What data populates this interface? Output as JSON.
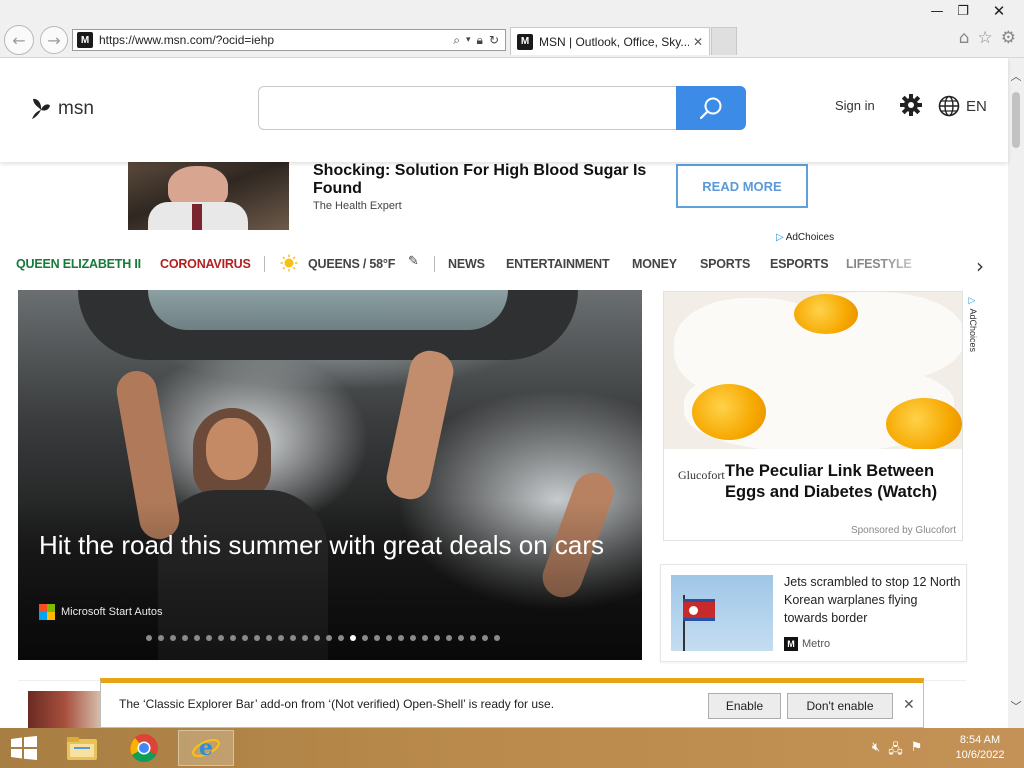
{
  "browser": {
    "url": "https://www.msn.com/?ocid=iehp",
    "tab_title": "MSN | Outlook, Office, Sky...",
    "favicon_letter": "M"
  },
  "header": {
    "brand": "msn",
    "search_placeholder": "",
    "signin": "Sign in",
    "language": "EN"
  },
  "banner_ad": {
    "headline": "Shocking: Solution For High Blood Sugar Is Found",
    "source": "The Health Expert",
    "cta": "READ MORE",
    "adchoices": "AdChoices"
  },
  "nav": {
    "items": [
      "QUEEN ELIZABETH II",
      "CORONAVIRUS",
      "NEWS",
      "ENTERTAINMENT",
      "MONEY",
      "SPORTS",
      "ESPORTS",
      "LIFESTYLE"
    ],
    "weather": "QUEENS / 58°F",
    "colors": {
      "queen": "#167a3a",
      "corona": "#b32020"
    }
  },
  "hero": {
    "title": "Hit the road this summer with great deals on cars",
    "source": "Microsoft Start Autos",
    "slide_count": 30,
    "active_slide": 17
  },
  "side_ad": {
    "brand": "Glucofort",
    "title": "The Peculiar Link Between Eggs and Diabetes (Watch)",
    "sponsor": "Sponsored by Glucofort",
    "adchoices": "AdChoices"
  },
  "news": {
    "title": "Jets scrambled to stop 12 North Korean warplanes flying towards border",
    "source": "Metro"
  },
  "notification": {
    "message": "The ‘Classic Explorer Bar’ add-on from ‘(Not verified) Open-Shell’ is ready for use.",
    "enable": "Enable",
    "dont_enable": "Don't enable"
  },
  "taskbar": {
    "time": "8:54 AM",
    "date": "10/6/2022"
  }
}
